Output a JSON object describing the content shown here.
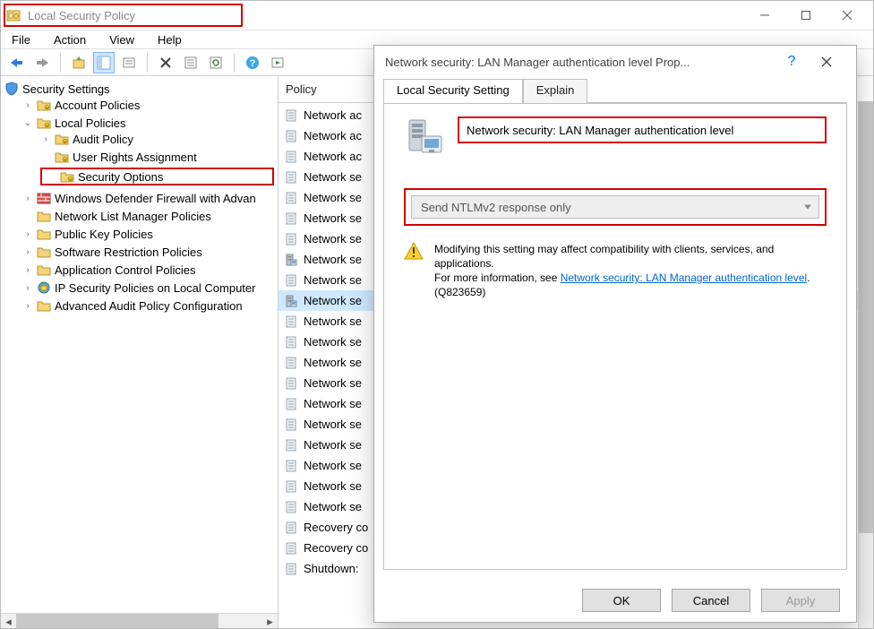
{
  "window": {
    "title": "Local Security Policy",
    "menus": [
      "File",
      "Action",
      "View",
      "Help"
    ]
  },
  "tree": {
    "root": "Security Settings",
    "items": [
      {
        "label": "Account Policies",
        "expand": ">",
        "icon": "folder-lock"
      },
      {
        "label": "Local Policies",
        "expand": "v",
        "icon": "folder-lock",
        "children": [
          {
            "label": "Audit Policy",
            "expand": ">",
            "icon": "folder-lock"
          },
          {
            "label": "User Rights Assignment",
            "icon": "folder-lock"
          },
          {
            "label": "Security Options",
            "icon": "folder-lock",
            "hl": true
          }
        ]
      },
      {
        "label": "Windows Defender Firewall with Advan",
        "expand": ">",
        "icon": "firewall"
      },
      {
        "label": "Network List Manager Policies",
        "icon": "folder"
      },
      {
        "label": "Public Key Policies",
        "expand": ">",
        "icon": "folder"
      },
      {
        "label": "Software Restriction Policies",
        "expand": ">",
        "icon": "folder"
      },
      {
        "label": "Application Control Policies",
        "expand": ">",
        "icon": "folder"
      },
      {
        "label": "IP Security Policies on Local Computer",
        "expand": ">",
        "icon": "ipsec"
      },
      {
        "label": "Advanced Audit Policy Configuration",
        "expand": ">",
        "icon": "folder"
      }
    ]
  },
  "list": {
    "header": "Policy",
    "rows": [
      {
        "t": "Network ac"
      },
      {
        "t": "Network ac"
      },
      {
        "t": "Network ac"
      },
      {
        "t": "Network se"
      },
      {
        "t": "Network se"
      },
      {
        "t": "Network se"
      },
      {
        "t": "Network se"
      },
      {
        "t": "Network se",
        "srv": true
      },
      {
        "t": "Network se"
      },
      {
        "t": "Network se",
        "sel": true,
        "srv": true
      },
      {
        "t": "Network se"
      },
      {
        "t": "Network se"
      },
      {
        "t": "Network se"
      },
      {
        "t": "Network se"
      },
      {
        "t": "Network se"
      },
      {
        "t": "Network se"
      },
      {
        "t": "Network se"
      },
      {
        "t": "Network se"
      },
      {
        "t": "Network se"
      },
      {
        "t": "Network se"
      },
      {
        "t": "Recovery co"
      },
      {
        "t": "Recovery co"
      },
      {
        "t": "Shutdown:"
      }
    ]
  },
  "dialog": {
    "title": "Network security: LAN Manager authentication level Prop...",
    "tabs": {
      "active": "Local Security Setting",
      "other": "Explain"
    },
    "header_label": "Network security: LAN Manager authentication level",
    "combo_value": "Send NTLMv2 response only",
    "warning_l1": "Modifying this setting may affect compatibility with clients, services, and applications.",
    "warning_l2a": "For more information, see ",
    "warning_link": "Network security: LAN Manager authentication level",
    "warning_l2b": ". (Q823659)",
    "btn_ok": "OK",
    "btn_cancel": "Cancel",
    "btn_apply": "Apply"
  }
}
